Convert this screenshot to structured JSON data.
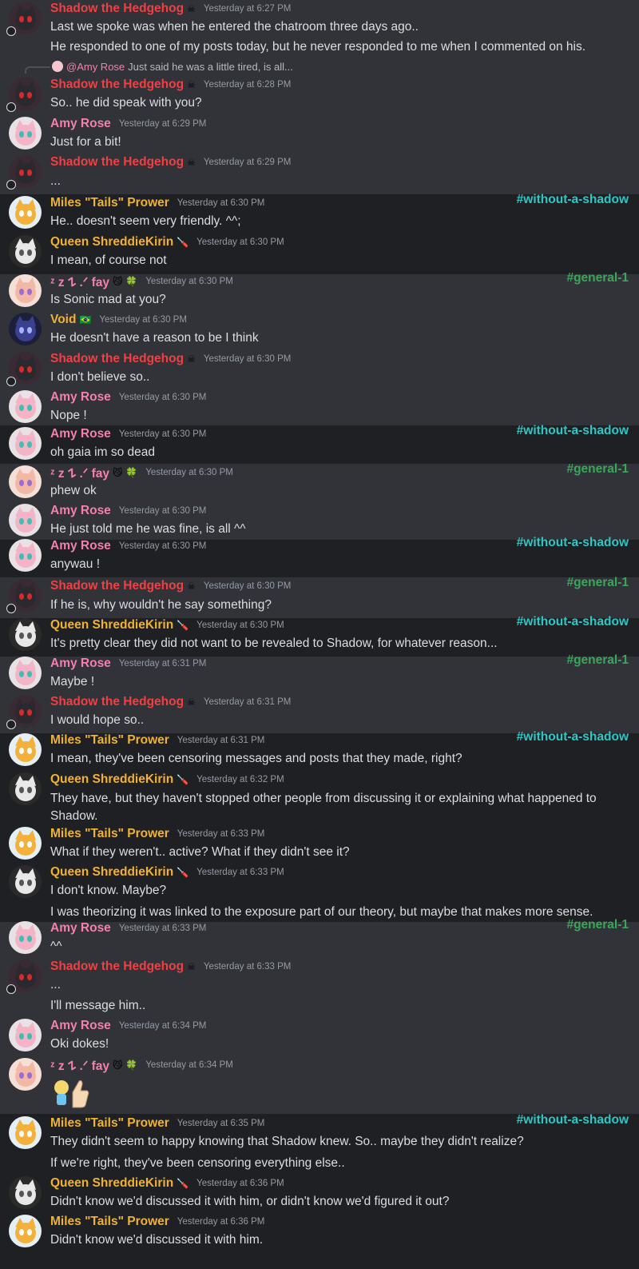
{
  "users": {
    "shadow": {
      "name": "Shadow the Hedgehog",
      "color": "#f23f43",
      "badge": "☠"
    },
    "amy": {
      "name": "Amy Rose",
      "color": "#f47fb0"
    },
    "tails": {
      "name": "Miles \"Tails\" Prower",
      "color": "#f0b232"
    },
    "queen": {
      "name": "Queen ShreddieKirin",
      "color": "#f0b232",
      "badge": "🪛"
    },
    "fay": {
      "name": "ᶻ z 𐰁 .ᐟ fay",
      "color": "#f47fb0",
      "badge": "😼 🍀"
    },
    "void": {
      "name": "Void",
      "color": "#f0b232",
      "badge": "🇧🇷"
    }
  },
  "channels": {
    "without": {
      "label": "#without-a-shadow",
      "color": "#2dc7c4"
    },
    "general": {
      "label": "#general-1",
      "color": "#3ba55c"
    }
  },
  "messages": [
    {
      "user": "shadow",
      "time": "Yesterday at 6:27 PM",
      "lines": [
        "Last we spoke was when he entered the chatroom three days ago..",
        "He responded to one of my posts today, but he never responded to me when I commented on his."
      ]
    },
    {
      "user": "shadow",
      "time": "Yesterday at 6:28 PM",
      "reply": {
        "mention": "@Amy Rose",
        "text": "Just said he was a little tired, is all..."
      },
      "lines": [
        "So.. he did speak with you?"
      ]
    },
    {
      "user": "amy",
      "time": "Yesterday at 6:29 PM",
      "lines": [
        "Just for a bit!"
      ]
    },
    {
      "user": "shadow",
      "time": "Yesterday at 6:29 PM",
      "lines": [
        "..."
      ]
    },
    {
      "user": "tails",
      "time": "Yesterday at 6:30 PM",
      "channel": "without",
      "lines": [
        "He.. doesn't seem very friendly. ^^;"
      ]
    },
    {
      "user": "queen",
      "time": "Yesterday at 6:30 PM",
      "lines": [
        "I mean, of course not"
      ]
    },
    {
      "user": "fay",
      "time": "Yesterday at 6:30 PM",
      "channel": "general",
      "lines": [
        "Is Sonic mad at you?"
      ]
    },
    {
      "user": "void",
      "time": "Yesterday at 6:30 PM",
      "lines": [
        "He doesn't have a reason to be I think"
      ]
    },
    {
      "user": "shadow",
      "time": "Yesterday at 6:30 PM",
      "lines": [
        "I don't believe so.."
      ]
    },
    {
      "user": "amy",
      "time": "Yesterday at 6:30 PM",
      "lines": [
        "Nope !"
      ]
    },
    {
      "user": "amy",
      "time": "Yesterday at 6:30 PM",
      "channel": "without",
      "lines": [
        "oh gaia im so dead"
      ]
    },
    {
      "user": "fay",
      "time": "Yesterday at 6:30 PM",
      "channel": "general",
      "lines": [
        "phew ok"
      ]
    },
    {
      "user": "amy",
      "time": "Yesterday at 6:30 PM",
      "lines": [
        "He just told me he was fine, is all ^^"
      ]
    },
    {
      "user": "amy",
      "time": "Yesterday at 6:30 PM",
      "channel": "without",
      "lines": [
        "anywau !"
      ]
    },
    {
      "user": "shadow",
      "time": "Yesterday at 6:30 PM",
      "channel": "general",
      "lines": [
        "If he is, why wouldn't he say something?"
      ]
    },
    {
      "user": "queen",
      "time": "Yesterday at 6:30 PM",
      "channel": "without",
      "lines": [
        "It's pretty clear they did not want to be revealed to Shadow, for whatever reason..."
      ]
    },
    {
      "user": "amy",
      "time": "Yesterday at 6:31 PM",
      "channel": "general",
      "lines": [
        "Maybe !"
      ]
    },
    {
      "user": "shadow",
      "time": "Yesterday at 6:31 PM",
      "lines": [
        "I would hope so.."
      ]
    },
    {
      "user": "tails",
      "time": "Yesterday at 6:31 PM",
      "channel": "without",
      "lines": [
        "I mean, they've been censoring messages and posts that they made, right?"
      ]
    },
    {
      "user": "queen",
      "time": "Yesterday at 6:32 PM",
      "lines": [
        "They have, but they haven't stopped other people from discussing it or explaining what happened to Shadow."
      ]
    },
    {
      "user": "tails",
      "time": "Yesterday at 6:33 PM",
      "lines": [
        "What if they weren't.. active? What if they didn't see it?"
      ]
    },
    {
      "user": "queen",
      "time": "Yesterday at 6:33 PM",
      "lines": [
        "I don't know. Maybe?",
        "I was theorizing it was linked to the exposure part of our theory, but maybe that makes more sense."
      ]
    },
    {
      "user": "amy",
      "time": "Yesterday at 6:33 PM",
      "channel": "general",
      "lines": [
        "^^"
      ]
    },
    {
      "user": "shadow",
      "time": "Yesterday at 6:33 PM",
      "lines": [
        "...",
        "I'll message him.."
      ]
    },
    {
      "user": "amy",
      "time": "Yesterday at 6:34 PM",
      "lines": [
        "Oki dokes!"
      ]
    },
    {
      "user": "fay",
      "time": "Yesterday at 6:34 PM",
      "lines": []
    },
    {
      "user": "tails",
      "time": "Yesterday at 6:35 PM",
      "channel": "without",
      "lines": [
        "They didn't seem to happy knowing that Shadow knew. So.. maybe they didn't realize?",
        "If we're right, they've been censoring everything else.."
      ]
    },
    {
      "user": "queen",
      "time": "Yesterday at 6:36 PM",
      "lines": [
        "Didn't know we'd discussed it with him, or didn't know we'd figured it out?"
      ]
    },
    {
      "user": "tails",
      "time": "Yesterday at 6:36 PM",
      "lines": [
        "Didn't know we'd discussed it with him."
      ]
    }
  ]
}
